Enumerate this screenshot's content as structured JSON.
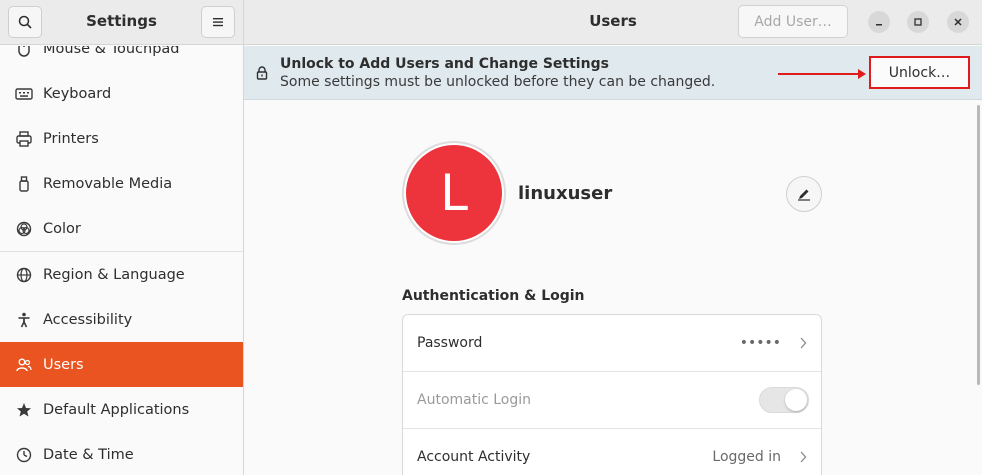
{
  "sidebar": {
    "title": "Settings",
    "items": [
      {
        "label": "Mouse & Touchpad",
        "icon": "mouse-icon"
      },
      {
        "label": "Keyboard",
        "icon": "keyboard-icon"
      },
      {
        "label": "Printers",
        "icon": "printer-icon"
      },
      {
        "label": "Removable Media",
        "icon": "removable-media-icon"
      },
      {
        "label": "Color",
        "icon": "color-icon"
      },
      {
        "label": "Region & Language",
        "icon": "globe-icon"
      },
      {
        "label": "Accessibility",
        "icon": "accessibility-icon"
      },
      {
        "label": "Users",
        "icon": "users-icon",
        "active": true
      },
      {
        "label": "Default Applications",
        "icon": "star-icon"
      },
      {
        "label": "Date & Time",
        "icon": "clock-icon"
      }
    ]
  },
  "header": {
    "title": "Users",
    "add_user_label": "Add User…"
  },
  "banner": {
    "title": "Unlock to Add Users and Change Settings",
    "subtitle": "Some settings must be unlocked before they can be changed.",
    "unlock_label": "Unlock…"
  },
  "user": {
    "initial": "L",
    "name": "linuxuser"
  },
  "auth": {
    "section_title": "Authentication & Login",
    "rows": [
      {
        "label": "Password",
        "value": "•••••"
      },
      {
        "label": "Automatic Login",
        "toggle": false
      },
      {
        "label": "Account Activity",
        "value": "Logged in"
      }
    ]
  },
  "colors": {
    "accent": "#e95420",
    "avatar": "#ed333b",
    "highlight": "#e01b1b"
  }
}
